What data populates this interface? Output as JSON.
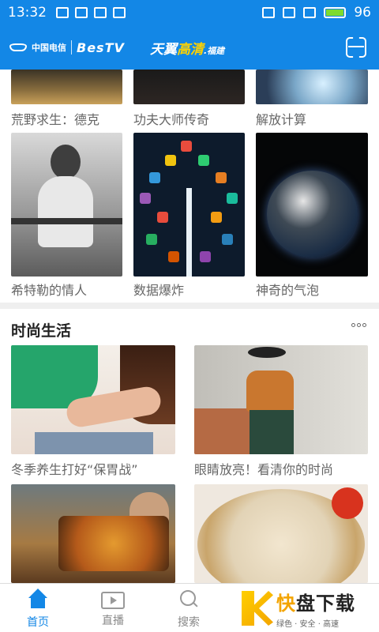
{
  "statusbar": {
    "time": "13:32",
    "battery": "96"
  },
  "header": {
    "carrier": "中国电信",
    "brand": "BesTV",
    "title_part1": "天翼",
    "title_part2": "高清",
    "title_suffix": ".福建"
  },
  "grid_top": {
    "captions": [
      "荒野求生：德克",
      "功夫大师传奇",
      "解放计算"
    ]
  },
  "grid_middle": {
    "captions": [
      "希特勒的情人",
      "数据爆炸",
      "神奇的气泡"
    ]
  },
  "section": {
    "title": "时尚生活"
  },
  "fashion": {
    "captions": [
      "冬季养生打好“保胃战”",
      "眼睛放亮！看清你的时尚"
    ]
  },
  "bottom_nav": {
    "items": [
      {
        "label": "首页",
        "icon": "home-icon",
        "active": true
      },
      {
        "label": "直播",
        "icon": "tv-icon",
        "active": false
      },
      {
        "label": "搜索",
        "icon": "search-icon",
        "active": false
      }
    ]
  },
  "watermark": {
    "text_main_1": "快",
    "text_main_2": "盘下载",
    "text_sub": "绿色 · 安全 · 高速"
  },
  "colors": {
    "primary": "#1387e6",
    "battery": "#7ddb2e"
  }
}
